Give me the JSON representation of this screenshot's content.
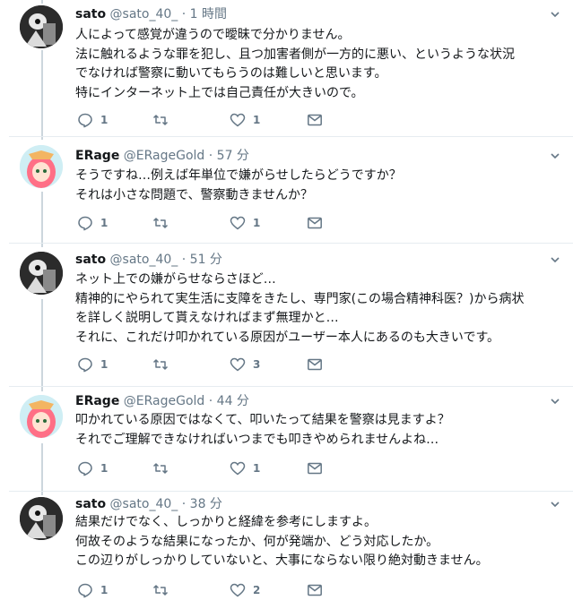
{
  "tweets": [
    {
      "name": "sato",
      "handle": "@sato_40_",
      "dot": "·",
      "time": "1 時間",
      "lines": [
        "人によって感覚が違うので曖昧で分かりません。",
        "法に触れるような罪を犯し、且つ加害者側が一方的に悪い、というような状況",
        "でなければ警察に動いてもらうのは難しいと思います。",
        "特にインターネット上では自己責任が大きいので。"
      ],
      "reply_count": "1",
      "retweet_count": "",
      "like_count": "1"
    },
    {
      "name": "ERage",
      "handle": "@ERageGold",
      "dot": "·",
      "time": "57 分",
      "lines": [
        "そうですね…例えば年単位で嫌がらせしたらどうですか？",
        "それは小さな問題で、警察動きませんか？"
      ],
      "reply_count": "1",
      "retweet_count": "",
      "like_count": "1"
    },
    {
      "name": "sato",
      "handle": "@sato_40_",
      "dot": "·",
      "time": "51 分",
      "lines": [
        "ネット上での嫌がらせならさほど…",
        "精神的にやられて実生活に支障をきたし、専門家(この場合精神科医？)から病状",
        "を詳しく説明して貰えなければまず無理かと…",
        "それに、これだけ叩かれている原因がユーザー本人にあるのも大きいです。"
      ],
      "reply_count": "1",
      "retweet_count": "",
      "like_count": "3"
    },
    {
      "name": "ERage",
      "handle": "@ERageGold",
      "dot": "·",
      "time": "44 分",
      "lines": [
        "叩かれている原因ではなくて、叩いたって結果を警察は見ますよ？",
        "それでご理解できなければいつまでも叩きやめられませんよね…"
      ],
      "reply_count": "1",
      "retweet_count": "",
      "like_count": "1"
    },
    {
      "name": "sato",
      "handle": "@sato_40_",
      "dot": "·",
      "time": "38 分",
      "lines": [
        "結果だけでなく、しっかりと経緯を参考にしますよ。",
        "何故そのような結果になったか、何が発端か、どう対応したか。",
        "この辺りがしっかりしていないと、大事にならない限り絶対動きません。"
      ],
      "reply_count": "1",
      "retweet_count": "",
      "like_count": "2"
    }
  ],
  "icons": {
    "reply": "reply-icon",
    "retweet": "retweet-icon",
    "like": "heart-icon",
    "dm": "envelope-icon",
    "menu": "chevron-down-icon"
  },
  "colors": {
    "text": "#14171a",
    "secondary": "#657786",
    "thread_line": "#ccd6dd",
    "separator": "#e6ecf0"
  }
}
